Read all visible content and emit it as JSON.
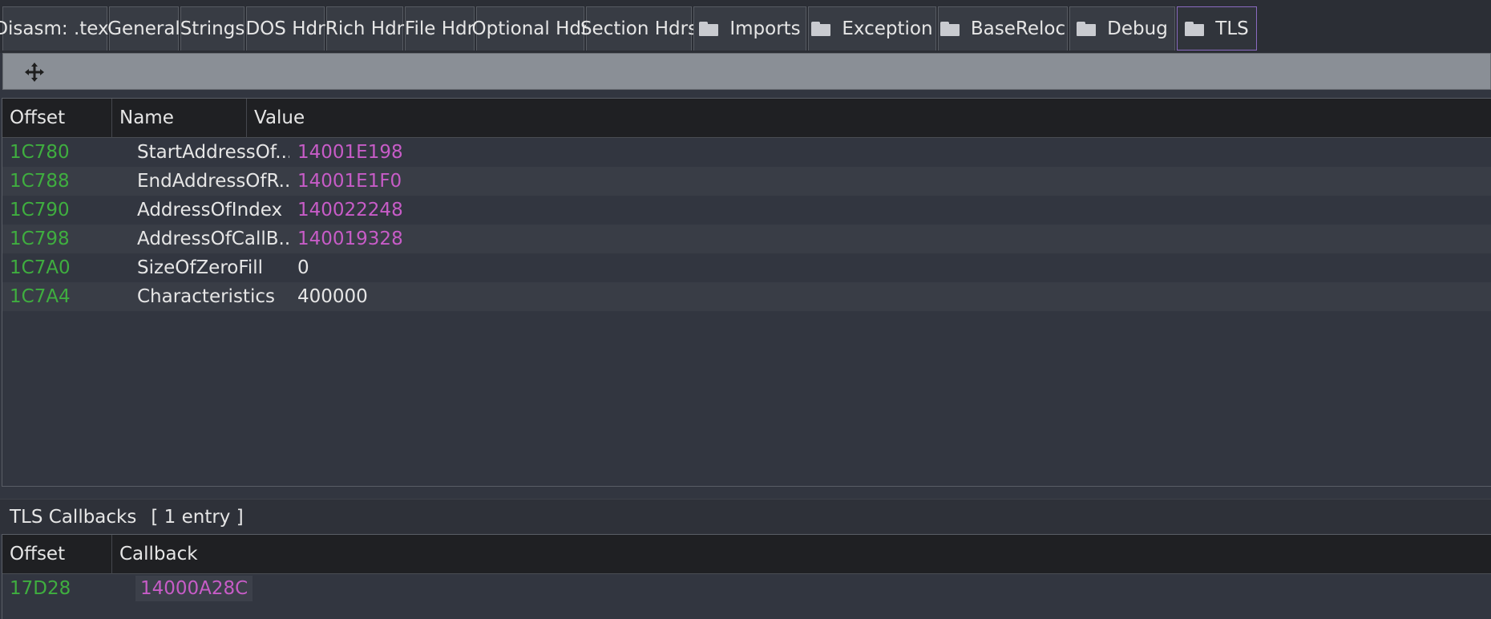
{
  "tabs": [
    {
      "label": "Disasm: .text",
      "folder": false
    },
    {
      "label": "General",
      "folder": false
    },
    {
      "label": "Strings",
      "folder": false
    },
    {
      "label": "DOS Hdr",
      "folder": false
    },
    {
      "label": "Rich Hdr",
      "folder": false
    },
    {
      "label": "File Hdr",
      "folder": false
    },
    {
      "label": "Optional Hdr",
      "folder": false
    },
    {
      "label": "Section Hdrs",
      "folder": false
    },
    {
      "label": "Imports",
      "folder": true
    },
    {
      "label": "Exception",
      "folder": true
    },
    {
      "label": "BaseReloc",
      "folder": true
    },
    {
      "label": "Debug",
      "folder": true
    },
    {
      "label": "TLS",
      "folder": true,
      "active": true
    }
  ],
  "toolbar": {
    "move_icon": "move-arrows-icon"
  },
  "tls_table": {
    "headers": {
      "offset": "Offset",
      "name": "Name",
      "value": "Value"
    },
    "rows": [
      {
        "offset": "1C780",
        "name": "StartAddressOf...",
        "value": "14001E198",
        "highlight": true
      },
      {
        "offset": "1C788",
        "name": "EndAddressOfR...",
        "value": "14001E1F0",
        "highlight": true
      },
      {
        "offset": "1C790",
        "name": "AddressOfIndex",
        "value": "140022248",
        "highlight": true
      },
      {
        "offset": "1C798",
        "name": "AddressOfCallB...",
        "value": "140019328",
        "highlight": true
      },
      {
        "offset": "1C7A0",
        "name": "SizeOfZeroFill",
        "value": "0",
        "highlight": false
      },
      {
        "offset": "1C7A4",
        "name": "Characteristics",
        "value": "400000",
        "highlight": false
      }
    ]
  },
  "callbacks": {
    "title": "TLS Callbacks",
    "count": "[ 1 entry ]",
    "headers": {
      "offset": "Offset",
      "callback": "Callback"
    },
    "rows": [
      {
        "offset": "17D28",
        "callback": "14000A28C"
      }
    ]
  },
  "colors": {
    "offset_green": "#3fae3f",
    "address_pink": "#c75cc7",
    "active_tab_border": "#8a6ac0"
  }
}
